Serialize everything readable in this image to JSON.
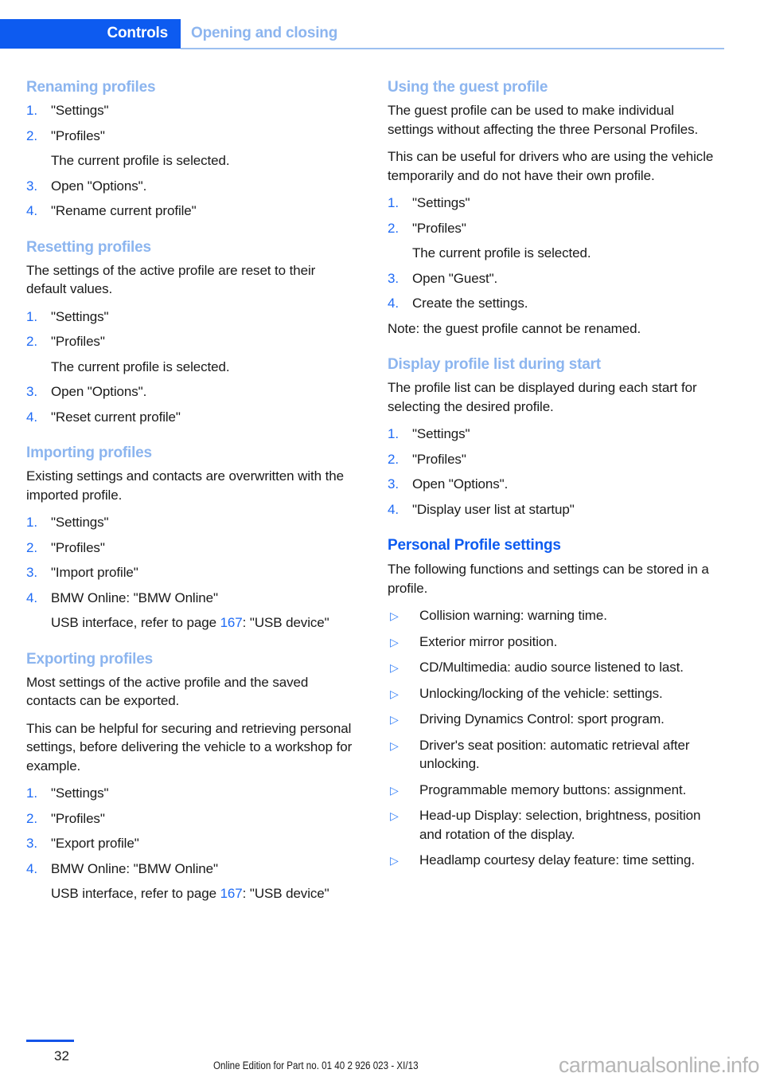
{
  "header": {
    "tab_label": "Controls",
    "section_label": "Opening and closing",
    "tab_bg": "#0d5bf0",
    "section_color": "#8cb5ef"
  },
  "colors": {
    "heading_major": "#0d5bf0",
    "heading_sub": "#8cb5ef",
    "list_number": "#1f6bf5",
    "cross_reference": "#1f6bf5",
    "bullet": "#2d7bf7",
    "body_text": "#1a1a1a"
  },
  "left_column": {
    "sections": [
      {
        "heading": "Renaming profiles",
        "heading_level": "sub",
        "steps": [
          {
            "num": "1.",
            "text": "\"Settings\""
          },
          {
            "num": "2.",
            "text": "\"Profiles\""
          },
          {
            "num": "",
            "text": "The current profile is selected."
          },
          {
            "num": "3.",
            "text": "Open \"Options\"."
          },
          {
            "num": "4.",
            "text": "\"Rename current profile\""
          }
        ]
      },
      {
        "heading": "Resetting profiles",
        "heading_level": "sub",
        "intro": "The settings of the active profile are reset to their default values.",
        "steps": [
          {
            "num": "1.",
            "text": "\"Settings\""
          },
          {
            "num": "2.",
            "text": "\"Profiles\""
          },
          {
            "num": "",
            "text": "The current profile is selected."
          },
          {
            "num": "3.",
            "text": "Open \"Options\"."
          },
          {
            "num": "4.",
            "text": "\"Reset current profile\""
          }
        ]
      },
      {
        "heading": "Importing profiles",
        "heading_level": "sub",
        "intro": "Existing settings and contacts are overwritten with the imported profile.",
        "steps": [
          {
            "num": "1.",
            "text": "\"Settings\""
          },
          {
            "num": "2.",
            "text": "\"Profiles\""
          },
          {
            "num": "3.",
            "text": "\"Import profile\""
          },
          {
            "num": "4.",
            "text": "BMW Online: \"BMW Online\""
          }
        ],
        "xref_note": {
          "before": "USB interface, refer to page ",
          "page": "167",
          "after": ": \"USB device\""
        }
      },
      {
        "heading": "Exporting profiles",
        "heading_level": "sub",
        "intro": "Most settings of the active profile and the saved contacts can be exported.",
        "intro2": "This can be helpful for securing and retrieving personal settings, before delivering the vehicle to a workshop for example.",
        "steps": [
          {
            "num": "1.",
            "text": "\"Settings\""
          },
          {
            "num": "2.",
            "text": "\"Profiles\""
          },
          {
            "num": "3.",
            "text": "\"Export profile\""
          },
          {
            "num": "4.",
            "text": "BMW Online: \"BMW Online\""
          }
        ],
        "xref_note": {
          "before": "USB interface, refer to page ",
          "page": "167",
          "after": ": \"USB device\""
        }
      }
    ]
  },
  "right_column": {
    "sections": [
      {
        "heading": "Using the guest profile",
        "heading_level": "sub",
        "intro": "The guest profile can be used to make individual settings without affecting the three Personal Profiles.",
        "intro2": "This can be useful for drivers who are using the vehicle temporarily and do not have their own profile.",
        "steps": [
          {
            "num": "1.",
            "text": "\"Settings\""
          },
          {
            "num": "2.",
            "text": "\"Profiles\""
          },
          {
            "num": "",
            "text": "The current profile is selected."
          },
          {
            "num": "3.",
            "text": "Open \"Guest\"."
          },
          {
            "num": "4.",
            "text": "Create the settings."
          }
        ],
        "outro": "Note: the guest profile cannot be renamed."
      },
      {
        "heading": "Display profile list during start",
        "heading_level": "sub",
        "intro": "The profile list can be displayed during each start for selecting the desired profile.",
        "steps": [
          {
            "num": "1.",
            "text": "\"Settings\""
          },
          {
            "num": "2.",
            "text": "\"Profiles\""
          },
          {
            "num": "3.",
            "text": "Open \"Options\"."
          },
          {
            "num": "4.",
            "text": "\"Display user list at startup\""
          }
        ]
      },
      {
        "heading": "Personal Profile settings",
        "heading_level": "major",
        "intro": "The following functions and settings can be stored in a profile.",
        "bullets": [
          "Collision warning: warning time.",
          "Exterior mirror position.",
          "CD/Multimedia: audio source listened to last.",
          "Unlocking/locking of the vehicle: settings.",
          "Driving Dynamics Control: sport program.",
          "Driver's seat position: automatic retrieval after unlocking.",
          "Programmable memory buttons: assignment.",
          "Head-up Display: selection, brightness, position and rotation of the display.",
          "Headlamp courtesy delay feature: time setting."
        ]
      }
    ]
  },
  "footer": {
    "page_number": "32",
    "edition": "Online Edition for Part no. 01 40 2 926 023 - XI/13",
    "watermark": "carmanualsonline.info"
  }
}
